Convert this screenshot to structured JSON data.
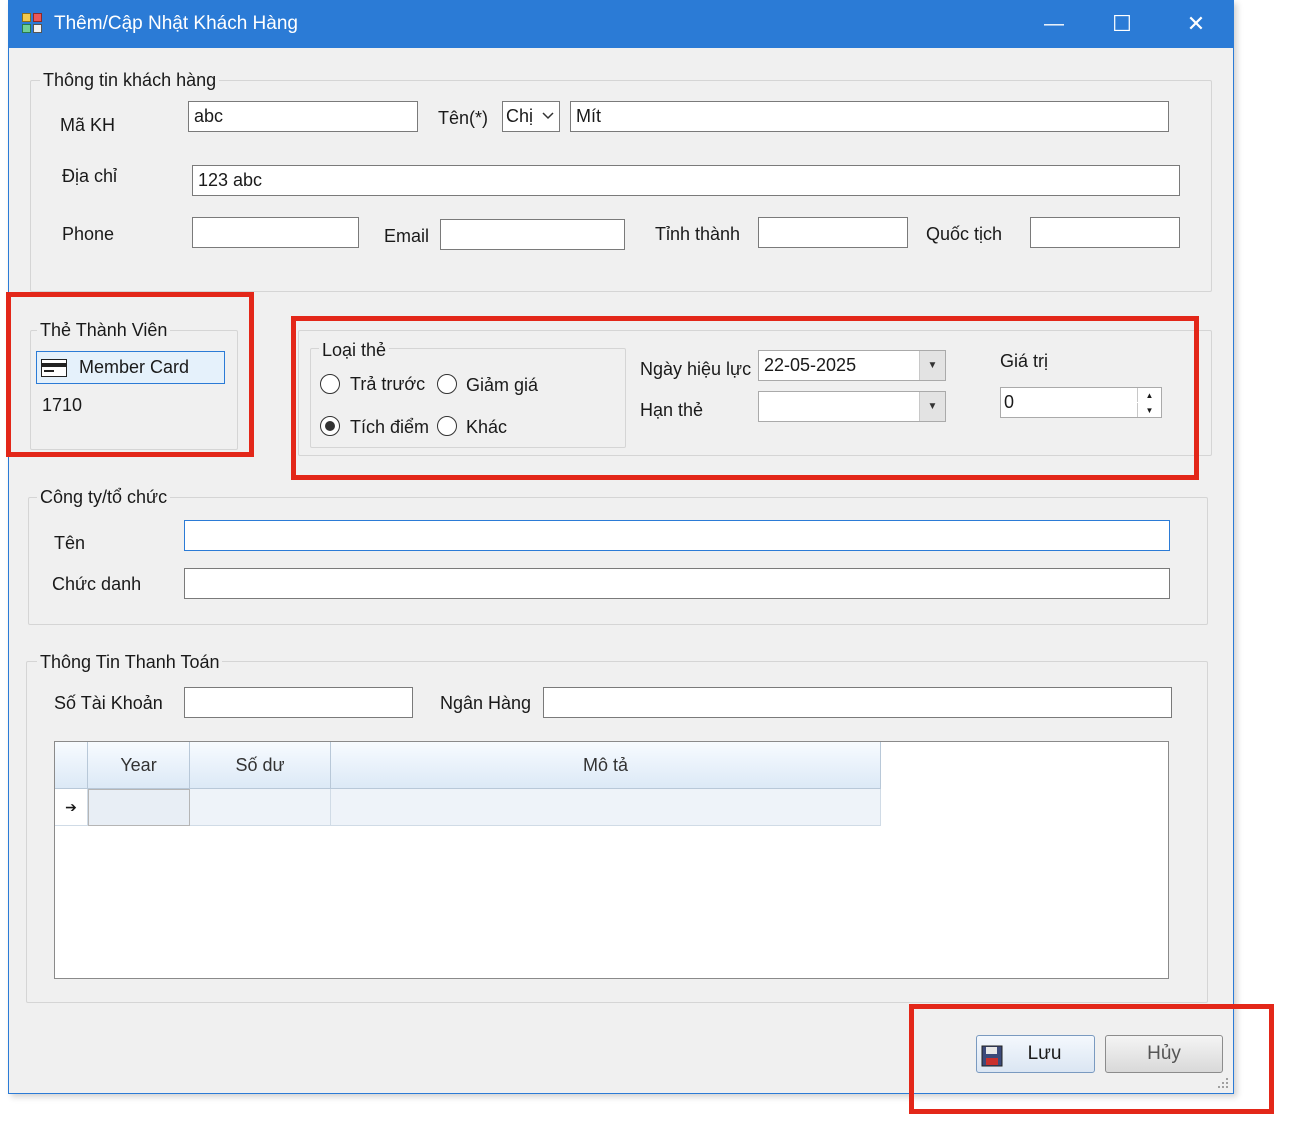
{
  "window": {
    "title": "Thêm/Cập Nhật Khách Hàng",
    "minimize_glyph": "—",
    "maximize_glyph": "☐",
    "close_glyph": "✕"
  },
  "customer_info": {
    "legend": "Thông tin khách hàng",
    "ma_kh_label": "Mã KH",
    "ma_kh_value": "abc",
    "ten_label": "Tên(*)",
    "salutation_value": "Chị",
    "ten_value": "Mít",
    "dia_chi_label": "Địa chỉ",
    "dia_chi_value": "123 abc",
    "phone_label": "Phone",
    "phone_value": "",
    "email_label": "Email",
    "email_value": "",
    "tinh_thanh_label": "Tỉnh thành",
    "tinh_thanh_value": "",
    "quoc_tich_label": "Quốc tịch",
    "quoc_tich_value": ""
  },
  "member": {
    "legend": "Thẻ Thành Viên",
    "card_button_label": "Member Card",
    "card_number": "1710"
  },
  "card_type": {
    "legend": "Loại thẻ",
    "options": [
      {
        "label": "Trả trước",
        "selected": false
      },
      {
        "label": "Giảm giá",
        "selected": false
      },
      {
        "label": "Tích điểm",
        "selected": true
      },
      {
        "label": "Khác",
        "selected": false
      }
    ],
    "ngay_hieu_luc_label": "Ngày hiệu lực",
    "ngay_hieu_luc_value": "22-05-2025",
    "han_the_label": "Hạn thẻ",
    "han_the_value": "",
    "gia_tri_label": "Giá trị",
    "gia_tri_value": "0"
  },
  "company": {
    "legend": "Công ty/tổ chức",
    "ten_label": "Tên",
    "ten_value": "",
    "chuc_danh_label": "Chức danh",
    "chuc_danh_value": ""
  },
  "payment": {
    "legend": "Thông Tin Thanh Toán",
    "so_tai_khoan_label": "Số Tài Khoản",
    "so_tai_khoan_value": "",
    "ngan_hang_label": "Ngân Hàng",
    "ngan_hang_value": "",
    "grid": {
      "columns": [
        "Year",
        "Số dư",
        "Mô tả"
      ],
      "row_indicator": "➔"
    }
  },
  "buttons": {
    "save_label": "Lưu",
    "cancel_label": "Hủy"
  },
  "colors": {
    "titlebar": "#2b7bd6",
    "highlight": "#e32719"
  }
}
